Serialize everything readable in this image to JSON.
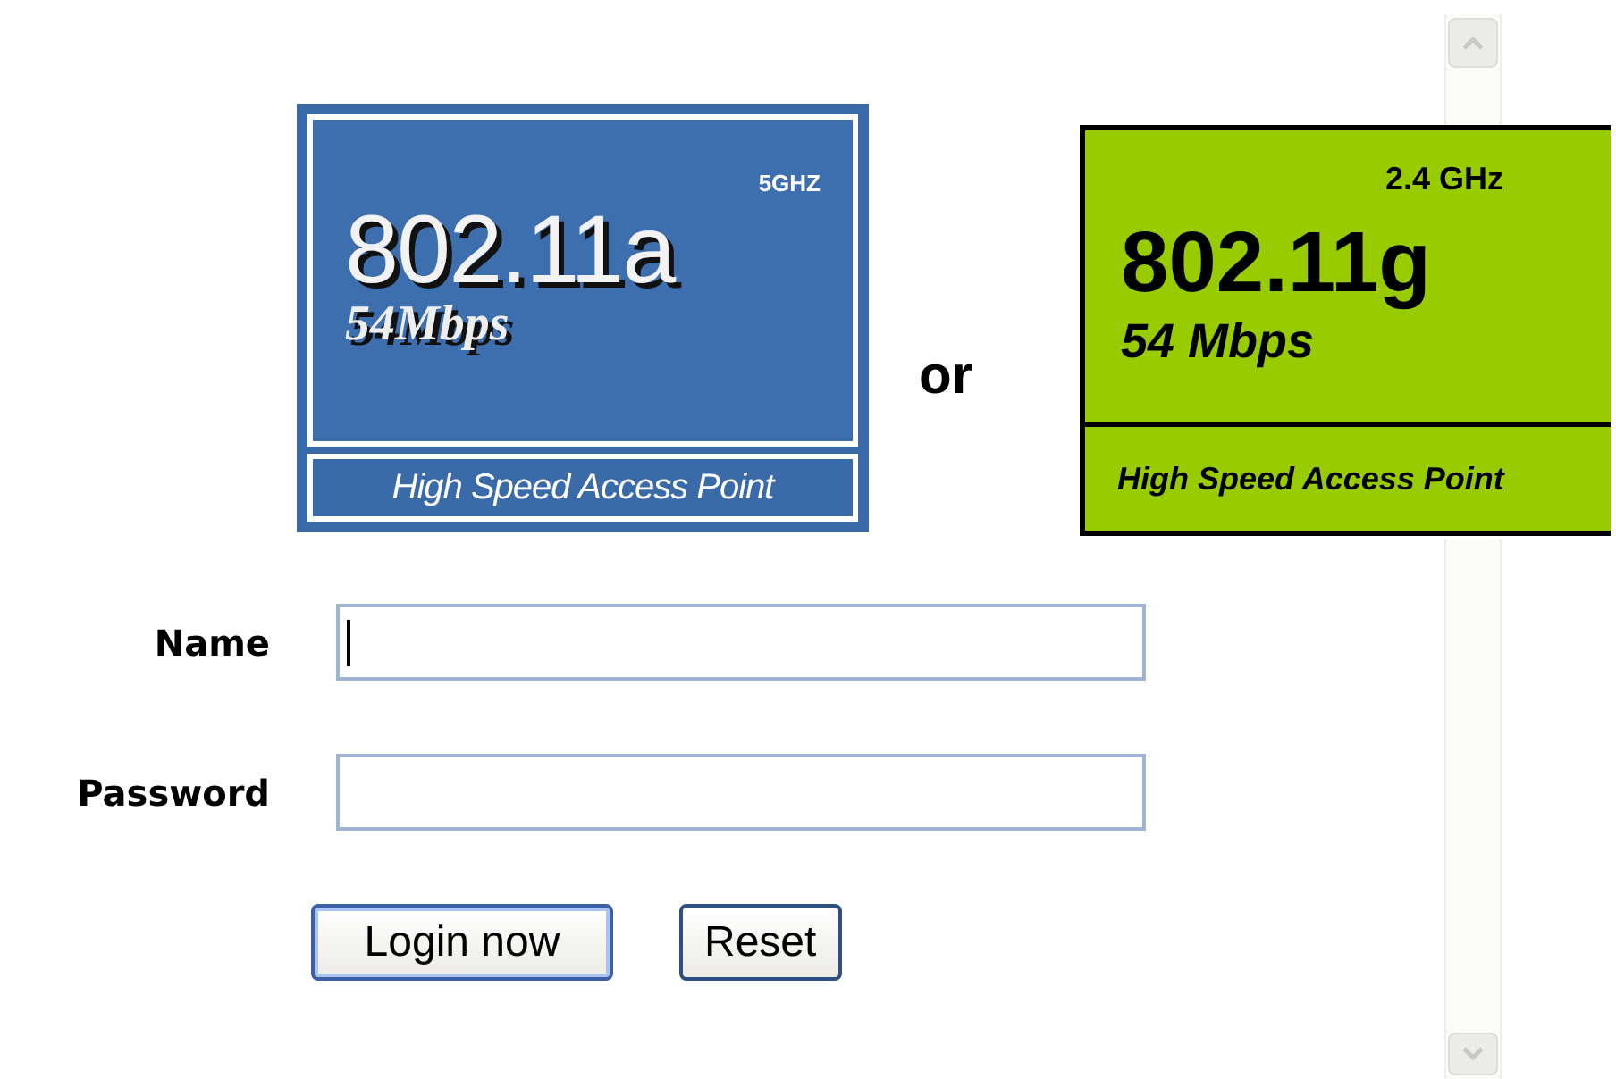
{
  "badge_a": {
    "band": "5GHZ",
    "standard": "802.11a",
    "speed": "54Mbps",
    "caption": "High Speed Access Point"
  },
  "separator": "or",
  "badge_g": {
    "band": "2.4 GHz",
    "standard": "802.11g",
    "speed": "54 Mbps",
    "caption": "High Speed Access Point"
  },
  "form": {
    "fields": [
      {
        "label": "Name",
        "focused": true
      },
      {
        "label": "Password",
        "focused": false
      }
    ],
    "buttons": [
      {
        "label": "Login now",
        "default": true
      },
      {
        "label": "Reset",
        "default": false
      }
    ]
  }
}
